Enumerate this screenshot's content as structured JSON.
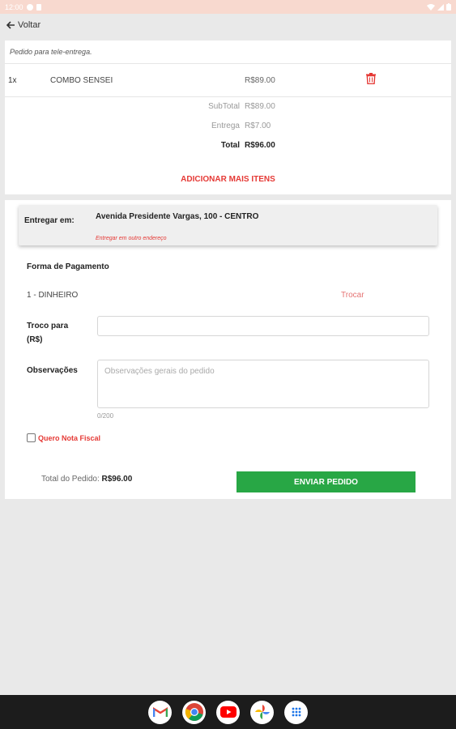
{
  "status_bar": {
    "time": "12:00"
  },
  "top_bar": {
    "back_label": "Voltar"
  },
  "order": {
    "caption": "Pedido para tele-entrega.",
    "items": [
      {
        "qty": "1x",
        "name": "COMBO SENSEI",
        "price": "R$89.00"
      }
    ],
    "subtotal_label": "SubTotal",
    "subtotal_value": "R$89.00",
    "delivery_label": "Entrega",
    "delivery_value": "R$7.00",
    "total_label": "Total",
    "total_value": "R$96.00",
    "add_items_label": "ADICIONAR MAIS ITENS"
  },
  "delivery": {
    "label": "Entregar em:",
    "address": "Avenida Presidente Vargas, 100 - CENTRO",
    "other_address_label": "Entregar em outro endereço"
  },
  "payment": {
    "title": "Forma de Pagamento",
    "method": "1 - DINHEIRO",
    "change_method_label": "Trocar",
    "troco_label_line1": "Troco para",
    "troco_label_line2": "(R$)",
    "troco_value": "",
    "obs_label": "Observações",
    "obs_placeholder": "Observações gerais do pedido",
    "obs_value": "",
    "obs_counter": "0/200",
    "nota_fiscal_label": "Quero Nota Fiscal",
    "nota_fiscal_checked": false
  },
  "footer": {
    "total_label": "Total do Pedido:",
    "total_value": "R$96.00",
    "send_label": "ENVIAR PEDIDO"
  },
  "colors": {
    "accent_red": "#e53935",
    "send_green": "#28a745",
    "status_bar": "#f8d9cf",
    "nav_bar": "#1c1c1c"
  },
  "nav_apps": [
    "gmail-icon",
    "chrome-icon",
    "youtube-icon",
    "photos-icon",
    "app-drawer-icon"
  ]
}
